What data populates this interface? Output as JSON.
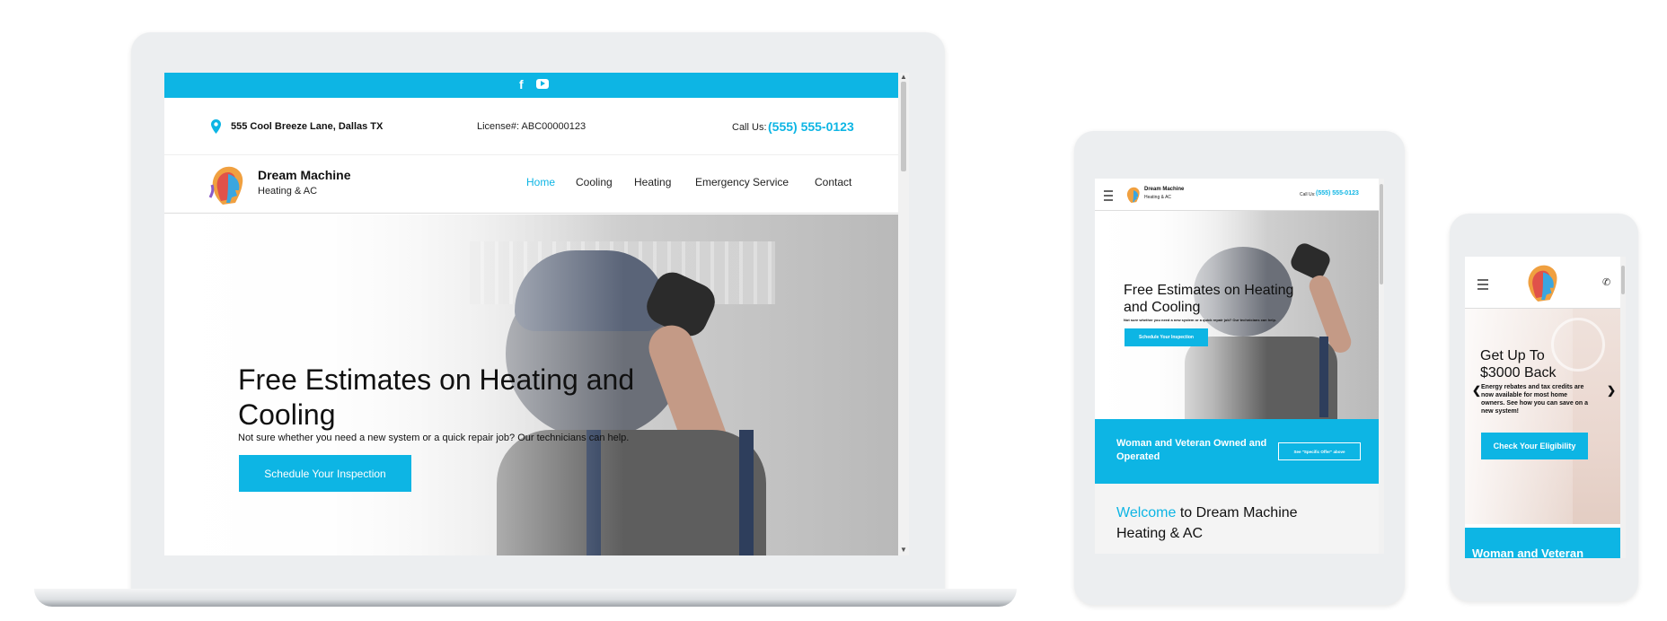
{
  "laptop": {
    "address": "555 Cool Breeze Lane, Dallas TX",
    "license": "License#: ABC00000123",
    "call_label": "Call Us:",
    "phone": "(555) 555-0123",
    "brand_name": "Dream Machine",
    "brand_sub": "Heating & AC",
    "nav": [
      "Home",
      "Cooling",
      "Heating",
      "Emergency Service",
      "Contact"
    ],
    "hero_title_line1": "Free Estimates on Heating and",
    "hero_title_line2": "Cooling",
    "hero_sub": "Not sure whether you need a new system or a quick repair job? Our technicians can help.",
    "cta": "Schedule Your Inspection",
    "social_icons": [
      "facebook-icon",
      "youtube-icon"
    ]
  },
  "tablet": {
    "brand_name": "Dream Machine",
    "brand_sub": "Heating & AC",
    "call_label": "Call Us:",
    "phone": "(555) 555-0123",
    "hero_title_line1": "Free Estimates on Heating",
    "hero_title_line2": "and Cooling",
    "hero_sub": "Not sure whether you need a new system or a quick repair job? Our technicians can help.",
    "cta": "Schedule Your Inspection",
    "band_text_line1": "Woman and Veteran Owned and",
    "band_text_line2": "Operated",
    "band_button": "See \"Specific Offer\" above",
    "welcome_accent": "Welcome",
    "welcome_rest_line1": " to Dream Machine",
    "welcome_line2": "Heating & AC"
  },
  "phone": {
    "slide_title_line1": "Get Up To",
    "slide_title_line2": "$3000 Back",
    "slide_text": "Energy rebates and tax credits are now available for most home owners. See how you can save on a new system!",
    "cta": "Check Your Eligibility",
    "band_text": "Woman and Veteran"
  },
  "colors": {
    "accent": "#0db5e4",
    "device_frame": "#eceef0",
    "text": "#111111"
  }
}
